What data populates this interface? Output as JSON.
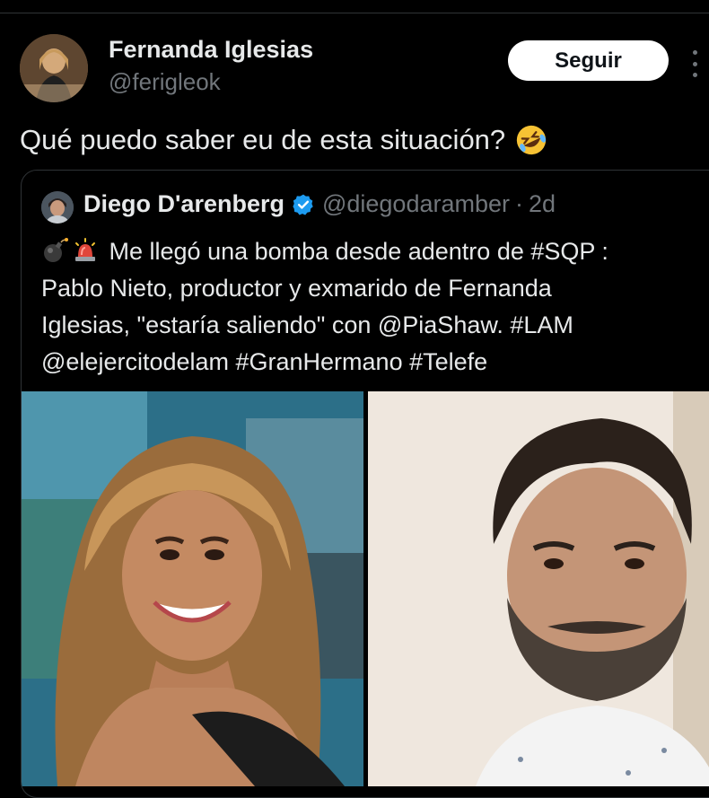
{
  "tweet": {
    "author_name": "Fernanda Iglesias",
    "author_handle": "@ferigleok",
    "follow_label": "Seguir",
    "text": "Qué puedo saber eu de esta situación?",
    "text_emoji": "rolling-on-floor-laughing-emoji"
  },
  "quoted": {
    "author_name": "Diego D'arenberg",
    "verified": true,
    "author_handle": "@diegodaramber",
    "separator": "·",
    "time": "2d",
    "lines": [
      "Me llegó una bomba desde adentro de #SQP :",
      "Pablo Nieto, productor y exmarido de Fernanda",
      "Iglesias, \"estaría saliendo\" con @PiaShaw. #LAM",
      "@elejercitodelam  #GranHermano #Telefe"
    ],
    "lead_emojis": [
      "bomb-emoji",
      "siren-emoji"
    ],
    "media": [
      "photo-woman-smiling",
      "photo-man-bearded"
    ]
  },
  "colors": {
    "background": "#000000",
    "text": "#e7e9ea",
    "muted": "#71767b",
    "border": "#2f3336",
    "verified": "#1d9bf0",
    "button_bg": "#ffffff"
  }
}
